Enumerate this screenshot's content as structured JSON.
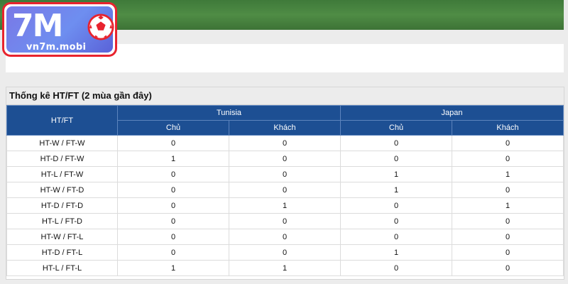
{
  "logo": {
    "mark": "7M",
    "site": "vn7m.mobi"
  },
  "stats": {
    "title": "Thống kê HT/FT (2 mùa gần đây)",
    "corner_label": "HT/FT",
    "teams": [
      "Tunisia",
      "Japan"
    ],
    "sub_headers": [
      "Chủ",
      "Khách",
      "Chủ",
      "Khách"
    ],
    "rows": [
      {
        "label": "HT-W / FT-W",
        "values": [
          "0",
          "0",
          "0",
          "0"
        ]
      },
      {
        "label": "HT-D / FT-W",
        "values": [
          "1",
          "0",
          "0",
          "0"
        ]
      },
      {
        "label": "HT-L / FT-W",
        "values": [
          "0",
          "0",
          "1",
          "1"
        ]
      },
      {
        "label": "HT-W / FT-D",
        "values": [
          "0",
          "0",
          "1",
          "0"
        ]
      },
      {
        "label": "HT-D / FT-D",
        "values": [
          "0",
          "1",
          "0",
          "1"
        ]
      },
      {
        "label": "HT-L / FT-D",
        "values": [
          "0",
          "0",
          "0",
          "0"
        ]
      },
      {
        "label": "HT-W / FT-L",
        "values": [
          "0",
          "0",
          "0",
          "0"
        ]
      },
      {
        "label": "HT-D / FT-L",
        "values": [
          "0",
          "0",
          "1",
          "0"
        ]
      },
      {
        "label": "HT-L / FT-L",
        "values": [
          "1",
          "1",
          "0",
          "0"
        ]
      }
    ]
  },
  "colors": {
    "header_blue": "#1d4f93",
    "logo_border": "#e8232e",
    "logo_fill": "#6e8ef0",
    "banner_green": "#4f8c45"
  }
}
